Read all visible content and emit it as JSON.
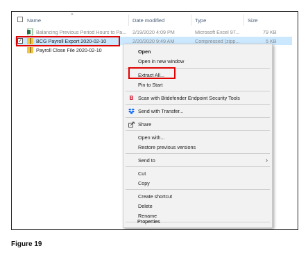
{
  "columns": {
    "name": "Name",
    "date_modified": "Date modified",
    "type": "Type",
    "size": "Size"
  },
  "files": [
    {
      "name": "Balancing Previous Period Hours to Pa...",
      "date": "2/19/2020 4:09 PM",
      "type": "Microsoft Excel 97...",
      "size": "79 KB",
      "icon": "excel-file-icon"
    },
    {
      "name": "BCG Payroll Export 2020-02-10",
      "date": "2/20/2020 9:49 AM",
      "type": "Compressed (zipp...",
      "size": "5 KB",
      "icon": "zip-folder-icon",
      "selected": true,
      "checked": "✓"
    },
    {
      "name": "Payroll Close File 2020-02-10",
      "date": "",
      "type": "",
      "size": "",
      "icon": "zip-folder-icon"
    }
  ],
  "context_menu": {
    "open": "Open",
    "open_new_window": "Open in new window",
    "extract_all": "Extract All...",
    "pin_to_start": "Pin to Start",
    "scan": "Scan with Bitdefender Endpoint Security Tools",
    "send_with_transfer": "Send with Transfer...",
    "share": "Share",
    "open_with": "Open with...",
    "restore_previous": "Restore previous versions",
    "send_to": "Send to",
    "cut": "Cut",
    "copy": "Copy",
    "create_shortcut": "Create shortcut",
    "delete": "Delete",
    "rename": "Rename",
    "properties": "Properties"
  },
  "icons": {
    "bitdefender": "B",
    "submenu_arrow": "›"
  },
  "caption": "Figure 19",
  "colors": {
    "highlight": "#e00000",
    "selection": "#cce8ff"
  }
}
